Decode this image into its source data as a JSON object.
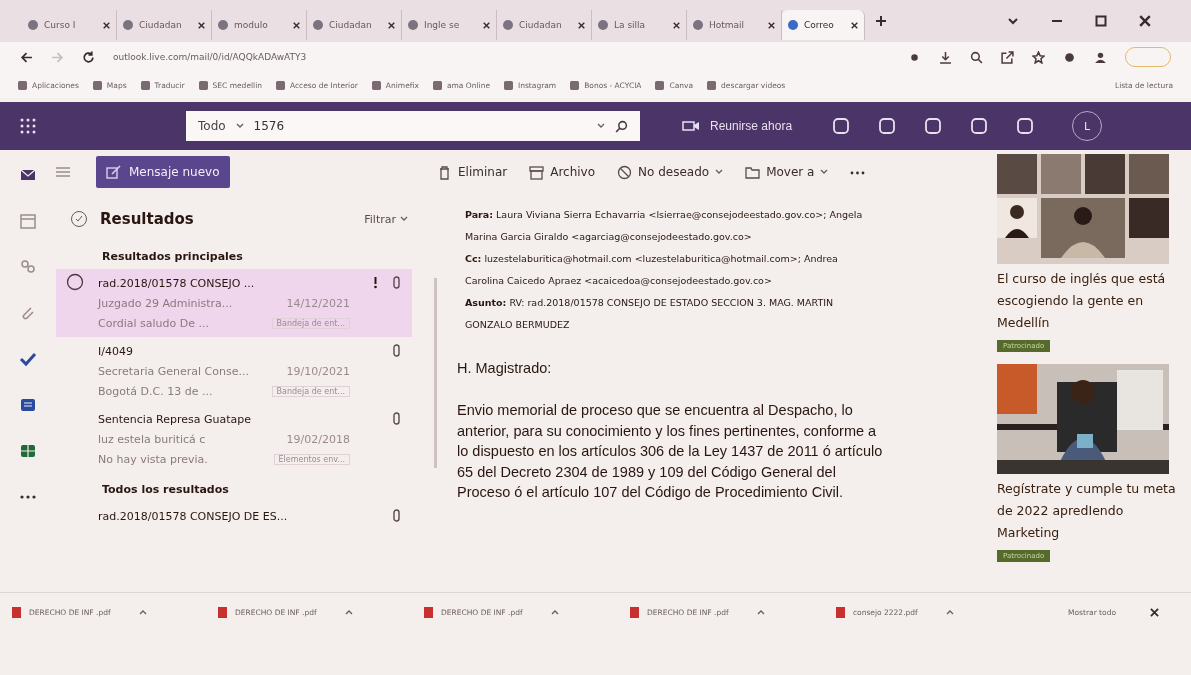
{
  "browser": {
    "tabs": [
      {
        "label": "Curso I",
        "selected": false
      },
      {
        "label": "Ciudadan",
        "selected": false
      },
      {
        "label": "modulo",
        "selected": false
      },
      {
        "label": "Ciudadan",
        "selected": false
      },
      {
        "label": "Ingle se",
        "selected": false
      },
      {
        "label": "Ciudadan",
        "selected": false
      },
      {
        "label": "La silla",
        "selected": false
      },
      {
        "label": "Hotmail",
        "selected": false
      },
      {
        "label": "Correo",
        "selected": true
      }
    ],
    "url": "outlook.live.com/mail/0/id/AQQkADAwATY3",
    "bookmarks": [
      "Aplicaciones",
      "Maps",
      "Traducir",
      "SEC medellin",
      "Acceso de Interior",
      "Animefix",
      "ama Online",
      "Instagram",
      "Bonos - ACYCIA",
      "Canva",
      "descargar videos"
    ],
    "reading_list": "Lista de lectura"
  },
  "header": {
    "scope": "Todo",
    "query": "1576",
    "meet": "Reunirse ahora",
    "avatar": "L"
  },
  "toolbar": {
    "new_message": "Mensaje nuevo",
    "actions": [
      {
        "label": "Eliminar",
        "kind": "trash"
      },
      {
        "label": "Archivo",
        "kind": "archive"
      },
      {
        "label": "No deseado",
        "kind": "block"
      },
      {
        "label": "Mover a",
        "kind": "folder"
      }
    ]
  },
  "results": {
    "title": "Resultados",
    "filter": "Filtrar",
    "sections": [
      {
        "heading": "Resultados principales",
        "messages": [
          {
            "subject": "rad.2018/01578 CONSEJO ...",
            "sender": "Juzgado 29 Administra...",
            "date": "14/12/2021",
            "preview": "Cordial saludo De ...",
            "folder": "Bandeja de ent...",
            "selected": true,
            "important": true,
            "attachment": true
          },
          {
            "subject": "I/4049",
            "sender": "Secretaria General Conse...",
            "date": "19/10/2021",
            "preview": "Bogotá D.C. 13 de ...",
            "folder": "Bandeja de ent...",
            "selected": false,
            "important": false,
            "attachment": true
          },
          {
            "subject": "Sentencia Represa Guatape",
            "sender": "luz estela buriticá c",
            "date": "19/02/2018",
            "preview": "No hay vista previa.",
            "folder": "Elementos env...",
            "selected": false,
            "important": false,
            "attachment": true
          }
        ]
      },
      {
        "heading": "Todos los resultados",
        "messages": [
          {
            "subject": "rad.2018/01578 CONSEJO DE ES...",
            "selected": false,
            "important": false,
            "attachment": true
          }
        ]
      }
    ]
  },
  "email": {
    "header_lines": [
      "**Para:** Laura Viviana Sierra Echavarria <lsierrae@consejodeestado.gov.co>; Angela Marina Garcia Giraldo <agarciag@consejodeestado.gov.co>",
      "**Cc:** luzestelaburitica@hotmail.com <luzestelaburitica@hotmail.com>; Andrea Carolina Caicedo Apraez <acaicedoa@consejodeestado.gov.co>",
      "**Asunto:** RV: rad.2018/01578 CONSEJO DE ESTADO SECCION 3. MAG. MARTIN GONZALO BERMUDEZ"
    ],
    "greeting": "H. Magistrado:",
    "body": "Envio memorial de proceso que se encuentra al Despacho, lo anterior, para su conocimiento y los fines pertinentes, conforme a lo dispuesto en los artículos 306 de la Ley 1437 de 2011 ó artículo 65 del Decreto 2304 de 1989 y 109 del Código General del Proceso ó  el artículo 107 del Código de Procedimiento Civil."
  },
  "ads": [
    {
      "text": "El curso de inglés que está escogiendo la gente en Medellín",
      "badge": "Patrocinado"
    },
    {
      "text": "Regístrate y cumple tu meta de 2022 apredIendo Marketing",
      "badge": "Patrocinado"
    }
  ],
  "downloads": {
    "files": [
      "DERECHO DE INF .pdf",
      "DERECHO DE INF .pdf",
      "DERECHO DE INF .pdf",
      "DERECHO DE INF .pdf",
      "consejo 2222.pdf"
    ],
    "show_all": "Mostrar todo"
  }
}
